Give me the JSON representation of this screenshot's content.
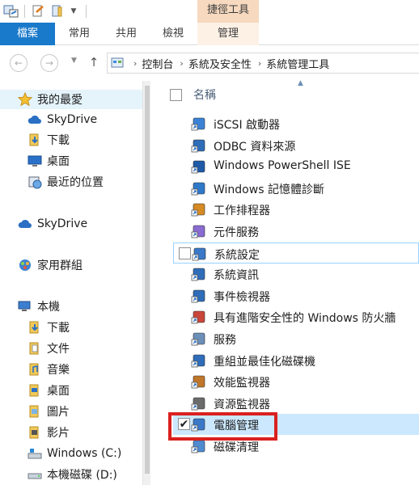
{
  "title_bar": {
    "context_tab_header": "捷徑工具"
  },
  "ribbon": {
    "tabs": [
      "檔案",
      "常用",
      "共用",
      "檢視",
      "管理"
    ],
    "accent": "#1979ca",
    "context_color": "#f6d9bf"
  },
  "address": {
    "breadcrumbs": [
      "控制台",
      "系統及安全性",
      "系統管理工具"
    ]
  },
  "nav": {
    "favorites": {
      "label": "我的最愛",
      "items": [
        "SkyDrive",
        "下載",
        "桌面",
        "最近的位置"
      ]
    },
    "skydrive": "SkyDrive",
    "homegroup": "家用群組",
    "computer": {
      "label": "本機",
      "items": [
        "下載",
        "文件",
        "音樂",
        "桌面",
        "圖片",
        "影片",
        "Windows (C:)",
        "本機磁碟 (D:)"
      ]
    }
  },
  "list": {
    "column_name": "名稱",
    "items": [
      "iSCSI 啟動器",
      "ODBC 資料來源",
      "Windows PowerShell ISE",
      "Windows 記憶體診斷",
      "工作排程器",
      "元件服務",
      "系統設定",
      "系統資訊",
      "事件檢視器",
      "具有進階安全性的 Windows 防火牆",
      "服務",
      "重組並最佳化磁碟機",
      "效能監視器",
      "資源監視器",
      "電腦管理",
      "磁碟清理"
    ],
    "hovered_item": "系統設定",
    "selected_item": "電腦管理",
    "highlight_color": "#d9211f"
  }
}
